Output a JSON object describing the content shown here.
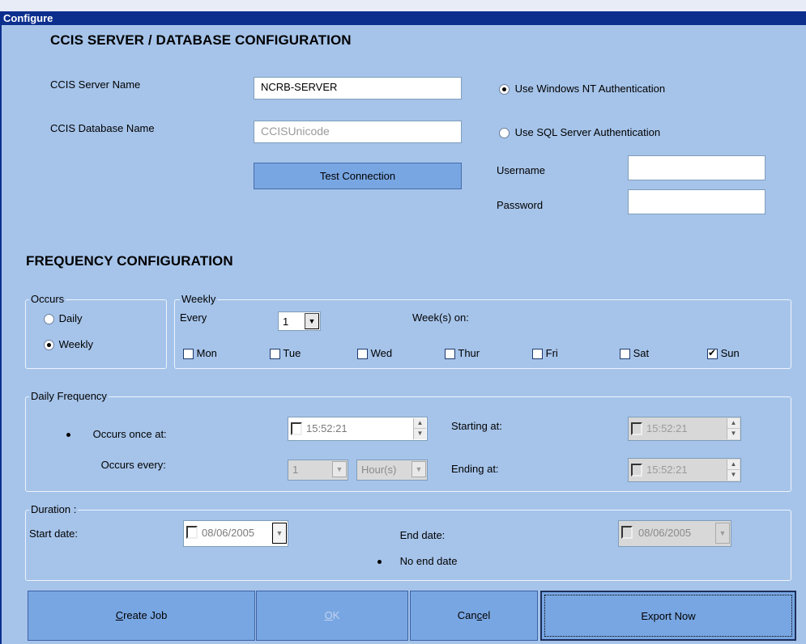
{
  "window": {
    "title": "Configure"
  },
  "server_section": {
    "heading": "CCIS SERVER / DATABASE CONFIGURATION",
    "server_name_label": "CCIS Server Name",
    "server_name_value": "NCRB-SERVER",
    "database_name_label": "CCIS Database Name",
    "database_name_value": "CCISUnicode",
    "test_connection_label": "Test Connection",
    "auth_nt_label": "Use Windows NT Authentication",
    "auth_nt_selected": true,
    "auth_sql_label": "Use SQL Server Authentication",
    "auth_sql_selected": false,
    "username_label": "Username",
    "username_value": "",
    "password_label": "Password",
    "password_value": ""
  },
  "frequency_section": {
    "heading": "FREQUENCY CONFIGURATION",
    "occurs": {
      "legend": "Occurs",
      "daily_label": "Daily",
      "weekly_label": "Weekly",
      "selected": "Weekly"
    },
    "weekly": {
      "legend": "Weekly",
      "every_label": "Every",
      "every_value": "1",
      "weeks_on_label": "Week(s) on:",
      "days": [
        {
          "label": "Mon",
          "checked": false
        },
        {
          "label": "Tue",
          "checked": false
        },
        {
          "label": "Wed",
          "checked": false
        },
        {
          "label": "Thur",
          "checked": false
        },
        {
          "label": "Fri",
          "checked": false
        },
        {
          "label": "Sat",
          "checked": false
        },
        {
          "label": "Sun",
          "checked": true
        }
      ]
    },
    "daily_frequency": {
      "legend": "Daily Frequency",
      "once_label": "Occurs once at:",
      "once_time": "15:52:21",
      "every_label": "Occurs every:",
      "every_value": "1",
      "every_unit": "Hour(s)",
      "starting_label": "Starting at:",
      "starting_time": "15:52:21",
      "ending_label": "Ending at:",
      "ending_time": "15:52:21",
      "selected": "once"
    },
    "duration": {
      "legend": "Duration :",
      "start_date_label": "Start date:",
      "start_date_value": "08/06/2005",
      "end_date_label": "End date:",
      "end_date_value": "08/06/2005",
      "no_end_date_label": "No end date",
      "selected": "no_end_date"
    }
  },
  "buttons": {
    "create_job_prefix": "C",
    "create_job_rest": "reate Job",
    "ok_prefix": "O",
    "ok_rest": "K",
    "cancel_pre": "Can",
    "cancel_u": "c",
    "cancel_post": "el",
    "export_now": "Export  Now"
  }
}
